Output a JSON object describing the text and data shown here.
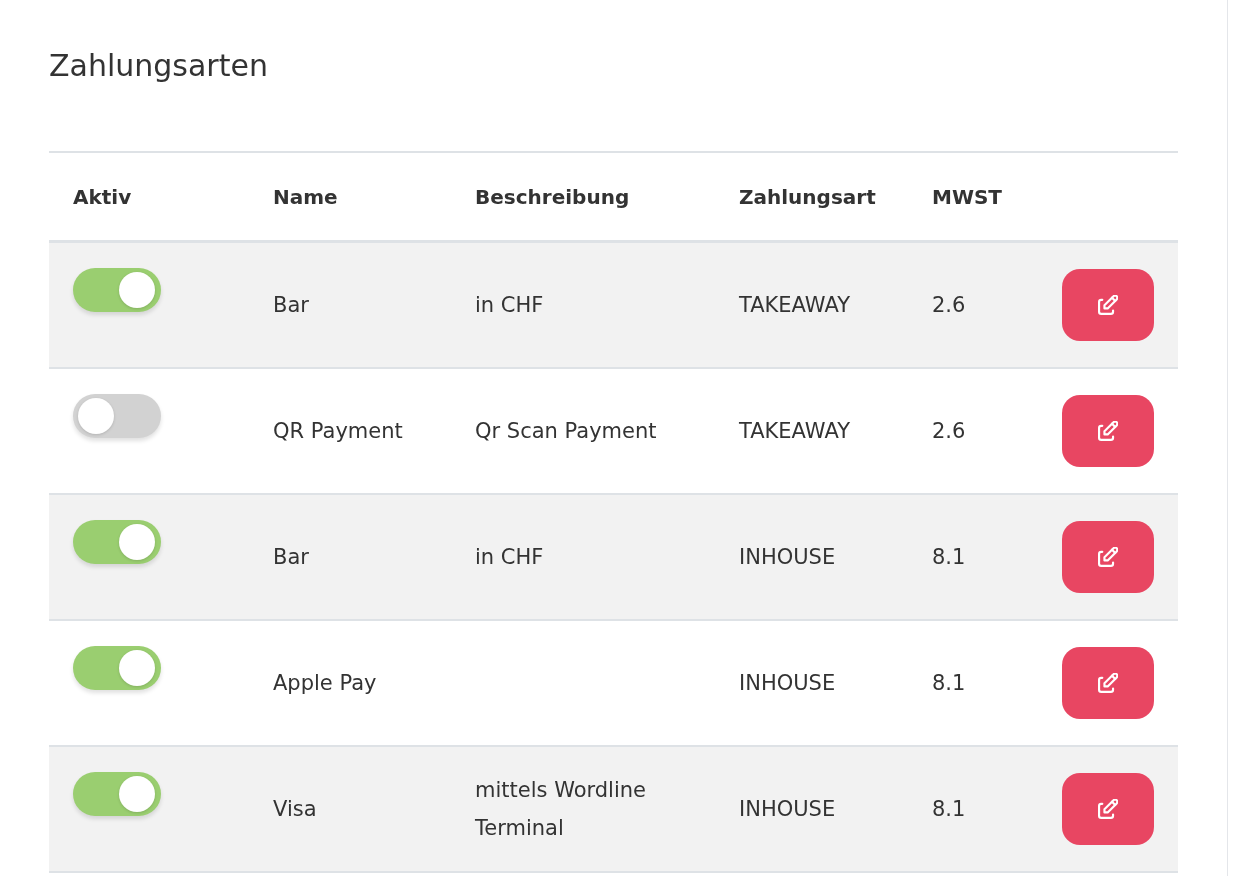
{
  "title": "Zahlungsarten",
  "table": {
    "columns": [
      "Aktiv",
      "Name",
      "Beschreibung",
      "Zahlungsart",
      "MWST"
    ],
    "rows": [
      {
        "active": true,
        "name": "Bar",
        "description": "in CHF",
        "payment_type": "TAKEAWAY",
        "vat": "2.6"
      },
      {
        "active": false,
        "name": "QR Payment",
        "description": "Qr Scan Payment",
        "payment_type": "TAKEAWAY",
        "vat": "2.6"
      },
      {
        "active": true,
        "name": "Bar",
        "description": "in CHF",
        "payment_type": "INHOUSE",
        "vat": "8.1"
      },
      {
        "active": true,
        "name": "Apple Pay",
        "payment_type": "INHOUSE",
        "vat": "8.1"
      },
      {
        "active": true,
        "name": "Visa",
        "description": "mittels Wordline Terminal",
        "payment_type": "INHOUSE",
        "vat": "8.1"
      }
    ]
  }
}
